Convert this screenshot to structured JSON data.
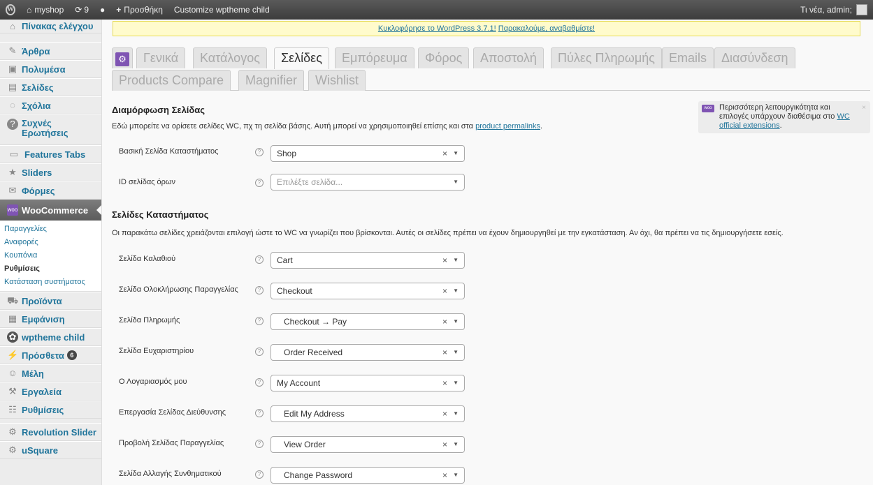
{
  "adminbar": {
    "site_name": "myshop",
    "updates_count": "9",
    "new_label": "Προσθήκη",
    "customize_label": "Customize wptheme child",
    "howdy": "Τι νέα, admin;"
  },
  "sidebar": {
    "items": [
      {
        "label": "Πίνακας ελέγχου",
        "icon": "home-icon"
      },
      {
        "label": "Άρθρα",
        "icon": "pin-icon"
      },
      {
        "label": "Πολυμέσα",
        "icon": "media-icon"
      },
      {
        "label": "Σελίδες",
        "icon": "pages-icon"
      },
      {
        "label": "Σχόλια",
        "icon": "comments-icon"
      },
      {
        "label": "Συχνές Ερωτήσεις",
        "icon": "question-icon"
      },
      {
        "label": "Features Tabs",
        "icon": "tabs-icon"
      },
      {
        "label": "Sliders",
        "icon": "star-icon"
      },
      {
        "label": "Φόρμες",
        "icon": "envelope-icon"
      },
      {
        "label": "WooCommerce",
        "icon": "woo-icon"
      }
    ],
    "woo_submenu": [
      "Παραγγελίες",
      "Αναφορές",
      "Κουπόνια",
      "Ρυθμίσεις",
      "Κατάσταση συστήματος"
    ],
    "items_after": [
      {
        "label": "Προϊόντα",
        "icon": "cart-icon"
      },
      {
        "label": "Εμφάνιση",
        "icon": "appearance-icon"
      },
      {
        "label": "wptheme child",
        "icon": "theme-icon"
      },
      {
        "label": "Πρόσθετα",
        "icon": "plugins-icon",
        "badge": "6"
      },
      {
        "label": "Μέλη",
        "icon": "users-icon"
      },
      {
        "label": "Εργαλεία",
        "icon": "tools-icon"
      },
      {
        "label": "Ρυθμίσεις",
        "icon": "settings-icon"
      },
      {
        "label": "Revolution Slider",
        "icon": "gear-icon"
      },
      {
        "label": "uSquare",
        "icon": "gear-icon"
      }
    ]
  },
  "nag": {
    "text": "Κυκλοφόρησε το WordPress 3.7.1!",
    "link": "Παρακαλούμε, αναβαθμίστε!"
  },
  "tabs": [
    "Γενικά",
    "Κατάλογος",
    "Σελίδες",
    "Εμπόρευμα",
    "Φόρος",
    "Αποστολή",
    "Πύλες Πληρωμής",
    "Emails",
    "Διασύνδεση",
    "Products Compare",
    "Magnifier",
    "Wishlist"
  ],
  "page_setup": {
    "title": "Διαμόρφωση Σελίδας",
    "desc": "Εδώ μπορείτε να ορίσετε σελίδες WC, πχ τη σελίδα βάσης. Αυτή μπορεί να χρησιμοποιηθεί επίσης και στα",
    "desc_link": "product permalinks",
    "rows": [
      {
        "label": "Βασική Σελίδα Καταστήματος",
        "value": "Shop"
      },
      {
        "label": "ID σελίδας όρων",
        "placeholder": "Επιλέξτε σελίδα..."
      }
    ]
  },
  "shop_pages": {
    "title": "Σελίδες Καταστήματος",
    "desc": "Οι παρακάτω σελίδες χρειάζονται επιλογή ώστε το WC να γνωρίζει που βρίσκονται. Αυτές οι σελίδες πρέπει να έχουν δημιουργηθεί με την εγκατάσταση. Αν όχι, θα πρέπει να τις δημιουργήσετε εσείς.",
    "rows": [
      {
        "label": "Σελίδα Καλαθιού",
        "value": "Cart"
      },
      {
        "label": "Σελίδα Ολοκλήρωσης Παραγγελίας",
        "value": "Checkout"
      },
      {
        "label": "Σελίδα Πληρωμής",
        "value": "Checkout → Pay"
      },
      {
        "label": "Σελίδα Ευχαριστηρίου",
        "value": "Order Received"
      },
      {
        "label": "Ο Λογαριασμός μου",
        "value": "My Account"
      },
      {
        "label": "Επεργασία Σελίδας Διεύθυνσης",
        "value": "Edit My Address"
      },
      {
        "label": "Προβολή Σελίδας Παραγγελίας",
        "value": "View Order"
      },
      {
        "label": "Σελίδα Αλλαγής Συνθηματικού",
        "value": "Change Password"
      }
    ]
  },
  "woo_notice": {
    "text": "Περισσότερη λειτουργικότητα και επιλογές υπάρχουν διαθέσιμα στο",
    "link": "WC official extensions",
    "icon_text": "woo"
  },
  "colors": {
    "accent": "#21759b",
    "woo": "#7f54b3",
    "nag_bg": "#fffbcc"
  }
}
